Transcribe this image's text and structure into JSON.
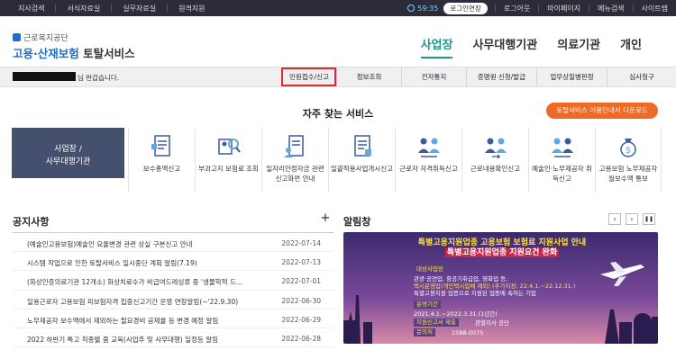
{
  "topbar": {
    "links_left": [
      "지사검색",
      "서식자료실",
      "실무자료실",
      "원격지원"
    ],
    "timer": "59:35",
    "extend_label": "로그인연장",
    "links_right": [
      "로그아웃",
      "마이페이지",
      "메뉴검색",
      "사이트맵"
    ]
  },
  "logo": {
    "org": "근로복지공단",
    "service_part1": "고용·산재보험",
    "service_part2": "토탈서비스"
  },
  "gnb": {
    "items": [
      "사업장",
      "사무대행기관",
      "의료기관",
      "개인"
    ],
    "active": "사업장"
  },
  "subnav": {
    "greeting": "님 반갑습니다.",
    "items": [
      "민원접수/신고",
      "정보조회",
      "전자통지",
      "증명원 신청/발급",
      "업무상질병판정",
      "심사청구"
    ],
    "highlighted": "민원접수/신고"
  },
  "services": {
    "title": "자주 찾는 서비스",
    "download_label": "토탈서비스 이용안내서 다운로드",
    "left_panel": [
      "사업장 /",
      "사무대행기관"
    ],
    "items": [
      {
        "label": "보수총액신고",
        "icon": "document-list-icon"
      },
      {
        "label": "부과고지 보험료 조회",
        "icon": "search-person-icon"
      },
      {
        "label": "일자리안정자금 관련 신고화면 안내",
        "icon": "document-person-icon"
      },
      {
        "label": "일괄적용사업개시신고",
        "icon": "document-list-icon"
      },
      {
        "label": "근로자 자격취득신고",
        "icon": "people-arrow-icon"
      },
      {
        "label": "근로내용확인신고",
        "icon": "people-arrow-icon"
      },
      {
        "label": "예술인·노무제공자 취득신고",
        "icon": "people-arrow-icon"
      },
      {
        "label": "고용보험 노무제공자 월보수액 통보",
        "icon": "money-bag-icon"
      }
    ]
  },
  "notice": {
    "title": "공지사항",
    "more_label": "+",
    "rows": [
      {
        "title": "(예술인고용보험)예술인 요율변경 관련 상실 구분신고 안내",
        "date": "2022-07-14"
      },
      {
        "title": "시스템 작업으로 인한 토탈서비스 일시중단 계획 알림(7.19)",
        "date": "2022-07-13"
      },
      {
        "title": "(화상인증의료기관 12개소) 화상치료수가 비급여드레싱류 중 '생물학적 드...",
        "date": "2022-07-01"
      },
      {
        "title": "일용근로자 고용보험 피보험자격 집중신고기간 운영 연장알림(~'22.9.30)",
        "date": "2022-06-30"
      },
      {
        "title": "노무제공자 보수액에서 제외하는 필요경비 공제율 등 변경 예정 알림",
        "date": "2022-06-29"
      },
      {
        "title": "2022 하반기 특고 직종별 줌 교육(사업주 및 사무대행) 일정등 알림",
        "date": "2022-06-28"
      }
    ]
  },
  "popup": {
    "title": "알림창",
    "prev": "‹",
    "next": "›",
    "pause": "❚❚",
    "banner": {
      "line1": "특별고용지원업종 고용보험 보험료 지원사업 안내",
      "line2": "특별고용지원업종 지원요건 완화",
      "target_label": "대상사업장",
      "target_text": "관광·공연업, 항공기취급업, 영화업 등,",
      "target_text2": "택시운영업(개인택시업체 제외)",
      "target_extra": "(추가지정: 22.4.1.~22.12.31.)",
      "target_text3": "특별고용지원 업종으로 지원된 업종에 속하는 기업",
      "period_label": "운영기간",
      "period_text": "2021.4.1.~2022.3.31.(1년간)",
      "apply_label": "지원신고서 제출",
      "apply_text": "관할지사 공단",
      "contact_label": "문의처",
      "contact_text": "1588-0075"
    }
  },
  "colors": {
    "topbar_bg": "#2b2b3a",
    "accent_teal": "#1a9a8a",
    "download_orange": "#ef6b25",
    "left_panel": "#454f6e",
    "highlight_red": "#e0292b",
    "banner_purple": "#4a3578"
  }
}
